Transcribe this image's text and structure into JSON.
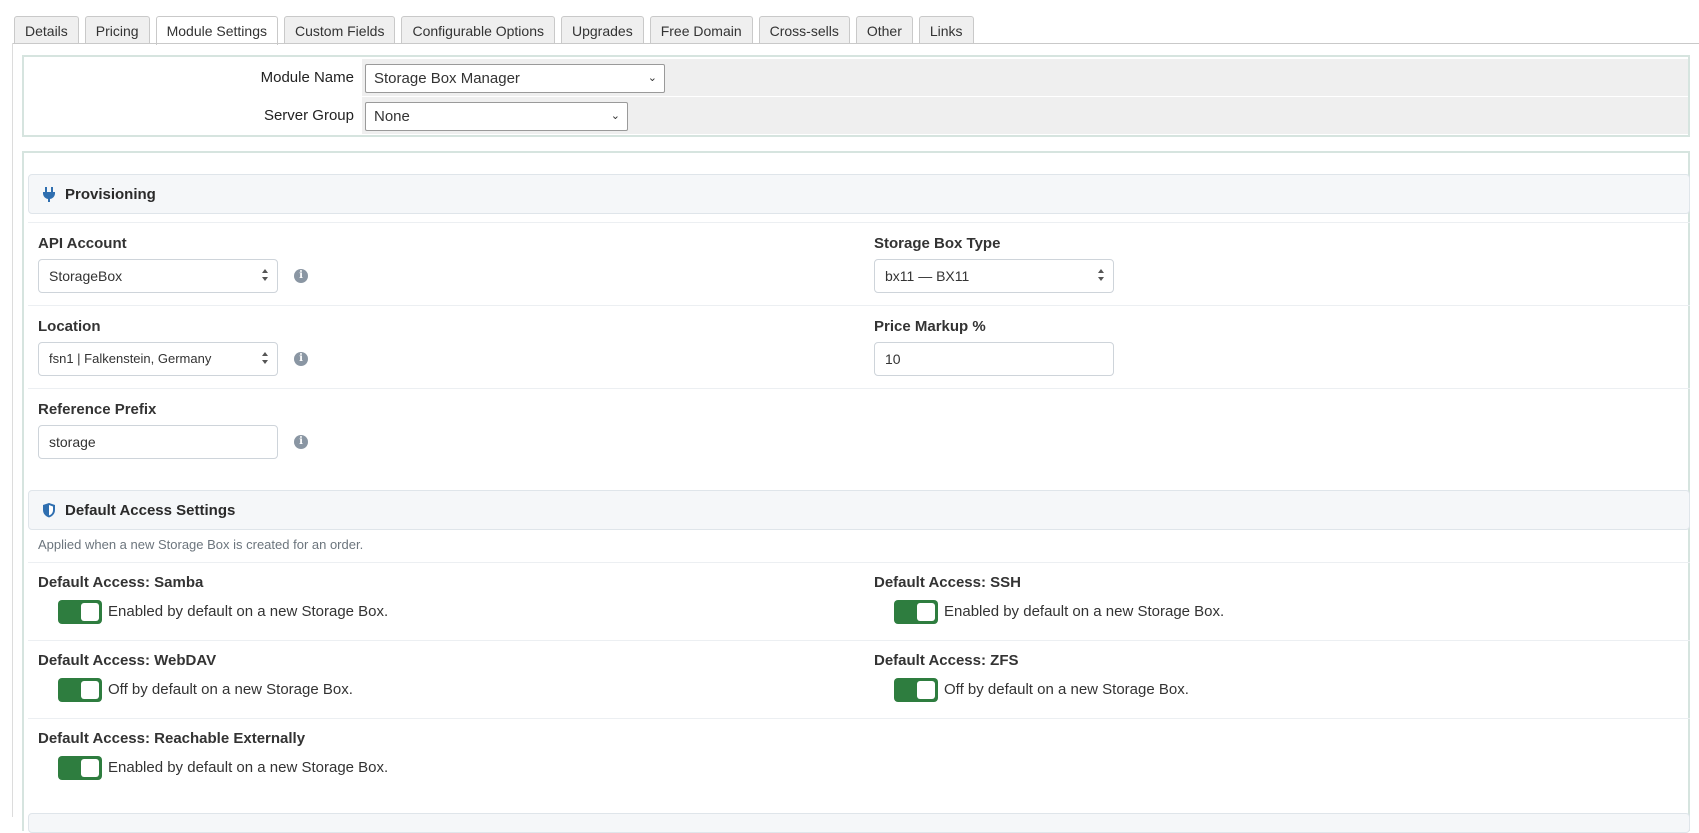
{
  "tabs": [
    {
      "label": "Details"
    },
    {
      "label": "Pricing"
    },
    {
      "label": "Module Settings"
    },
    {
      "label": "Custom Fields"
    },
    {
      "label": "Configurable Options"
    },
    {
      "label": "Upgrades"
    },
    {
      "label": "Free Domain"
    },
    {
      "label": "Cross-sells"
    },
    {
      "label": "Other"
    },
    {
      "label": "Links"
    }
  ],
  "active_tab": "Module Settings",
  "module": {
    "module_name_label": "Module Name",
    "module_name_value": "Storage Box Manager",
    "server_group_label": "Server Group",
    "server_group_value": "None"
  },
  "provisioning": {
    "title": "Provisioning",
    "api_account": {
      "label": "API Account",
      "value": "StorageBox"
    },
    "storage_box_type": {
      "label": "Storage Box Type",
      "value": "bx11 — BX11"
    },
    "location": {
      "label": "Location",
      "value": "fsn1 | Falkenstein, Germany"
    },
    "price_markup": {
      "label": "Price Markup %",
      "value": "10"
    },
    "reference_prefix": {
      "label": "Reference Prefix",
      "value": "storage"
    }
  },
  "access": {
    "title": "Default Access Settings",
    "hint": "Applied when a new Storage Box is created for an order.",
    "samba": {
      "label": "Default Access: Samba",
      "desc": "Enabled by default on a new Storage Box.",
      "enabled": true
    },
    "ssh": {
      "label": "Default Access: SSH",
      "desc": "Enabled by default on a new Storage Box.",
      "enabled": true
    },
    "webdav": {
      "label": "Default Access: WebDAV",
      "desc": "Off by default on a new Storage Box.",
      "enabled": true
    },
    "zfs": {
      "label": "Default Access: ZFS",
      "desc": "Off by default on a new Storage Box.",
      "enabled": true
    },
    "external": {
      "label": "Default Access: Reachable Externally",
      "desc": "Enabled by default on a new Storage Box.",
      "enabled": true
    }
  },
  "colors": {
    "toggle_on": "#2e7d3f",
    "icon_accent": "#2f6fb0",
    "section_bg": "#f5f7f9"
  }
}
